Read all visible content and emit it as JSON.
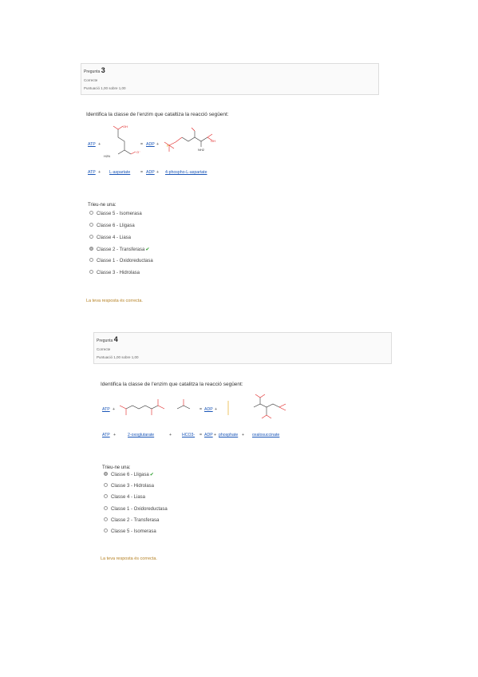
{
  "q3": {
    "label": "Pregunta",
    "number": "3",
    "state": "Correcte",
    "score": "Puntuació 1,00 sobre 1,00",
    "prompt": "Identifica la classe de l'enzim que cataltiza la reacció següent:",
    "row1": {
      "a": "ATP",
      "plus": "+",
      "arrow": "=",
      "b": "ADP",
      "plus2": "+"
    },
    "row2": {
      "a": "ATP",
      "plus": "+",
      "b": "L-aspartate",
      "arrow": "=",
      "c": "ADP",
      "plus2": "+",
      "d": "4-phospho-L-aspartate"
    },
    "mol": {
      "oh": "OH",
      "o": "O",
      "h2n": "H2N",
      "nh2": "NH2",
      "oh2": "O⁻",
      "p": "P"
    },
    "choose": "Trieu-ne una:",
    "options": [
      {
        "label": "Classe 5 - Isomerasa",
        "selected": false
      },
      {
        "label": "Classe 6 - Lligasa",
        "selected": false
      },
      {
        "label": "Classe 4 - Liasa",
        "selected": false
      },
      {
        "label": "Classe 2 - Transferasa",
        "selected": true
      },
      {
        "label": "Classe 1 - Oxidoreductasa",
        "selected": false
      },
      {
        "label": "Classe 3 - Hidrolasa",
        "selected": false
      }
    ],
    "feedback": "La teva resposta és correcta."
  },
  "q4": {
    "label": "Pregunta",
    "number": "4",
    "state": "Correcte",
    "score": "Puntuació 1,00 sobre 1,00",
    "prompt": "Identifica la classe de l'enzim que catalitza la reacció següent:",
    "row1": {
      "a": "ATP",
      "plus": "+",
      "arrow": "=",
      "b": "ADP",
      "plus2": "+"
    },
    "row2": {
      "a": "ATP",
      "plus": "+",
      "b": "2-oxoglutarate",
      "plus2": "+",
      "c": "HCO3-",
      "arrow": "=",
      "d": "ADP",
      "plus3": "+",
      "e": "phosphate",
      "plus4": "+",
      "f": "oxalosuccinate"
    },
    "choose": "Trieu-ne una:",
    "options": [
      {
        "label": "Classe 6 - Lligasa",
        "selected": true
      },
      {
        "label": "Classe 3 - Hidrolasa",
        "selected": false
      },
      {
        "label": "Classe 4 - Liasa",
        "selected": false
      },
      {
        "label": "Classe 1 - Oxidoreductasa",
        "selected": false
      },
      {
        "label": "Classe 2 - Transferasa",
        "selected": false
      },
      {
        "label": "Classe 5 - Isomerasa",
        "selected": false
      }
    ],
    "feedback": "La teva resposta és correcta."
  },
  "colors": {
    "link": "#1a56b8",
    "feedback": "#b58124",
    "check": "#2e9e2e",
    "bond_red": "#e02020"
  }
}
